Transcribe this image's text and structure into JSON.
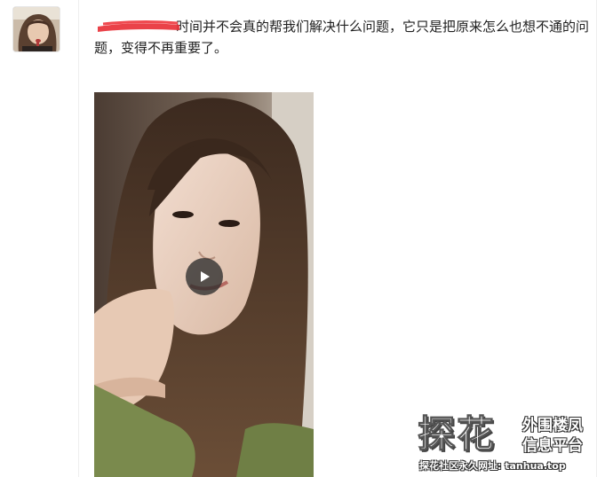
{
  "post": {
    "text": "时间并不会真的帮我们解决什么问题，它只是把原来怎么也想不通的问题，变得不再重要了。"
  },
  "video": {
    "play_icon": "play-icon"
  },
  "watermark": {
    "big": "探花",
    "right_line1": "外围楼凤",
    "right_line2": "信息平台",
    "url": "探花社区永久网址: tanhua.top"
  },
  "colors": {
    "redact": "#e8323a",
    "text": "#222222"
  }
}
